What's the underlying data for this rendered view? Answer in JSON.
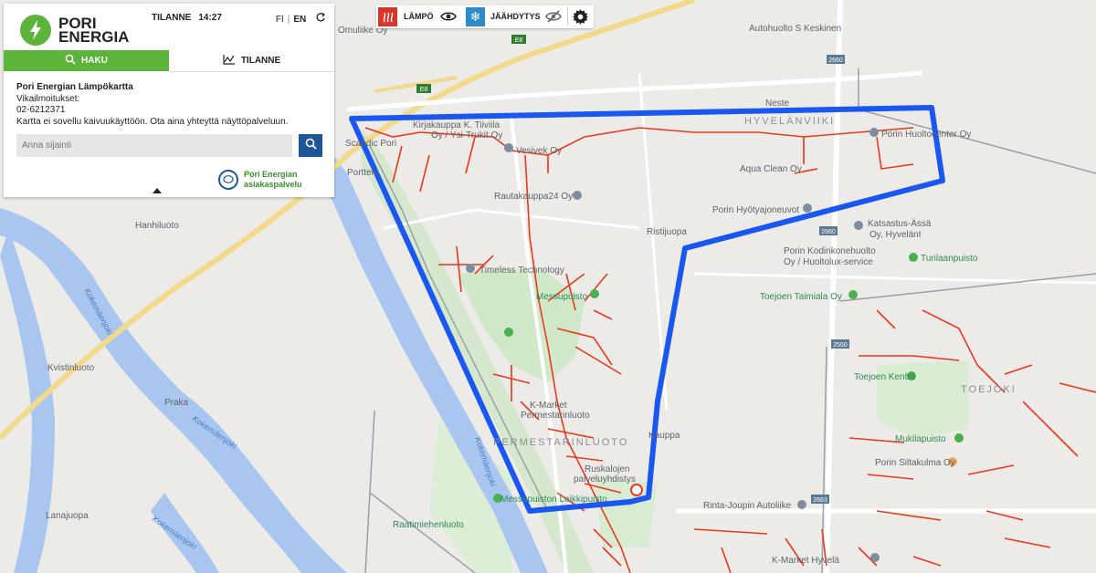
{
  "app": {
    "brand_line1": "PORI",
    "brand_line2": "ENERGIA",
    "status_label": "TILANNE",
    "status_time": "14:27",
    "lang_fi": "FI",
    "lang_en": "EN"
  },
  "tabs": {
    "search_label": "HAKU",
    "status_label": "TILANNE"
  },
  "info": {
    "title": "Pori Energian Lämpökartta",
    "fault_label": "Vikailmoitukset:",
    "fault_phone": "02-6212371",
    "notice": "Kartta ei sovellu kaivuukäyttöön. Ota aina yhteyttä näyttöpalveluun."
  },
  "search": {
    "placeholder": "Anna sijainti"
  },
  "service": {
    "line1": "Pori Energian",
    "line2": "asiakaspalvelu"
  },
  "layers": {
    "heat_label": "LÄMPÖ",
    "cool_label": "JÄÄHDYTYS"
  },
  "colors": {
    "brand_green": "#5db43a",
    "button_blue": "#1e5799",
    "heat_red": "#d8362a",
    "cool_blue": "#2d8bc9",
    "network_line": "#e8391e",
    "area_boundary": "#1a56f0"
  },
  "map": {
    "area_names": {
      "hyvelanviiki": "HYVELÄNVIIKI",
      "toejoki": "TOEJOKI",
      "permestarinluoto": "PERMESTARINLUOTO"
    },
    "places": {
      "autohuolto": "Autohuolto S Keskinen",
      "neste": "Neste",
      "porin_huoltocenter": "Porin Huoltocenter Oy",
      "aqua_clean": "Aqua Clean Oy",
      "vesivek": "Vesivek Oy",
      "rautakauppa": "Rautakauppa24 Oy",
      "hyotyajoneuvot": "Porin Hyötyajoneuvot",
      "ristijuopa": "Ristijuopa",
      "katsastus": "Katsastus-Ässä",
      "katsastus2": "Oy, Hyvelänt",
      "kodinkone1": "Porin Kodinkonehuolto",
      "kodinkone2": "Oy / Huoltolux-service",
      "turilaanpuisto": "Turilaanpuisto",
      "timeless": "Timeless Technology",
      "messupuisto": "Messupuisto",
      "toejoen_taimiala": "Toejoen Taimiala Oy",
      "kmarket_perm1": "K-Market",
      "kmarket_perm2": "Permestarinluoto",
      "kuuspa": "Kauppa",
      "toejoen_kentta": "Toejoen Kenttä",
      "mukilapuisto": "Mukilapuisto",
      "siltakulma": "Porin Siltakulma Oy",
      "rinta_joupin": "Rinta-Joupin Autoliike",
      "ruskalojen1": "Ruskalojen",
      "ruskalojen2": "palveluyhdistys",
      "messupuiston_leikki": "Messupuiston Leikkipuisto",
      "raatimiehenluoto": "Raatimiehenluoto",
      "hanhiluoto": "Hanhiluoto",
      "kvistinluoto": "Kvistinluoto",
      "praka": "Praka",
      "lanajuopa": "Lanajuopa",
      "porttelu": "Porttelu",
      "kmarket_hyv": "K-Market Hyvelä",
      "kokemaenjoki": "Kokemäenjoki",
      "scandic": "Scandic Pori",
      "kirjakauppa": "Kirjakauppa K. Tiiviila",
      "ysi_trukit": "Oy / Ysi-Trukit Oy",
      "ommuliike": "Omuliike Oy"
    },
    "roads": {
      "e8": "E8",
      "r2660": "2660",
      "r2663": "2663",
      "r2550": "2550"
    }
  }
}
